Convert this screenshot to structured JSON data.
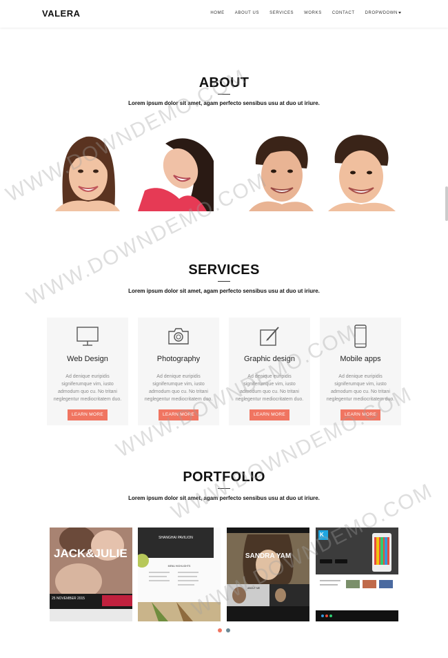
{
  "nav": {
    "logo": "VALERA",
    "items": [
      "HOME",
      "ABOUT US",
      "SERVICES",
      "WORKS",
      "CONTACT",
      "DROPWDOWN"
    ]
  },
  "about": {
    "title": "ABOUT",
    "subtitle": "Lorem ipsum dolor sit amet, agam perfecto sensibus usu at duo ut iriure."
  },
  "services": {
    "title": "SERVICES",
    "subtitle": "Lorem ipsum dolor sit amet, agam perfecto sensibus usu at duo ut iriure.",
    "cards": [
      {
        "icon": "monitor-icon",
        "title": "Web Design",
        "text": "Ad denique euripidis signiferumque vim, iusto admodum quo cu. No tritani neglegentur mediocritatem duo.",
        "button": "LEARN MORE"
      },
      {
        "icon": "camera-icon",
        "title": "Photography",
        "text": "Ad denique euripidis signiferumque vim, iusto admodum quo cu. No tritani neglegentur mediocritatem duo.",
        "button": "LEARN MORE"
      },
      {
        "icon": "pencil-frame-icon",
        "title": "Graphic design",
        "text": "Ad denique euripidis signiferumque vim, iusto admodum quo cu. No tritani neglegentur mediocritatem duo.",
        "button": "LEARN MORE"
      },
      {
        "icon": "phone-icon",
        "title": "Mobile apps",
        "text": "Ad denique euripidis signiferumque vim, iusto admodum quo cu. No tritani neglegentur mediocritatem duo.",
        "button": "LEARN MORE"
      }
    ]
  },
  "portfolio": {
    "title": "PORTFOLIO",
    "subtitle": "Lorem ipsum dolor sit amet, agam perfecto sensibus usu at duo ut iriure.",
    "items": [
      {
        "heading": "JACK&JULIE",
        "date": "25 NOVEMBER 2015"
      },
      {
        "heading": "SHANGHAI PAVILION",
        "sub": "MENU HIGHLIGHTS"
      },
      {
        "heading": "SANDRA YAM",
        "sub": "ABOUT ME"
      },
      {
        "heading": "K"
      }
    ]
  },
  "watermark": "WWW.DOWNDEMO.COM",
  "colors": {
    "accent": "#f07561",
    "card_bg": "#f6f6f6",
    "dot_active": "#f07561",
    "dot_inactive": "#6d8a96"
  }
}
